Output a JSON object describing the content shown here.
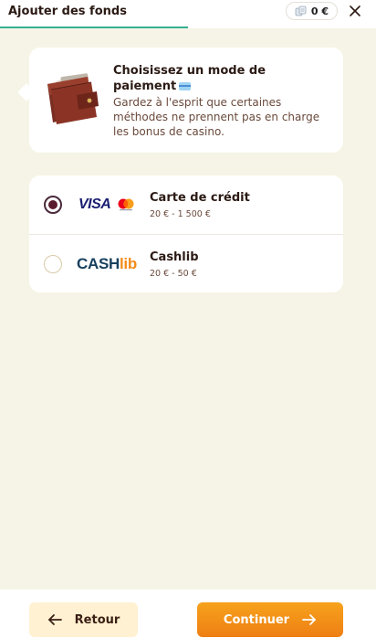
{
  "header": {
    "title": "Ajouter des fonds",
    "balance": "0 €",
    "progress_fraction": 0.5
  },
  "info": {
    "title": "Choisissez un mode de paiement",
    "text": "Gardez à l'esprit que certaines méthodes ne prennent pas en charge les bonus de casino."
  },
  "methods": [
    {
      "logo_text": "VISA",
      "name": "Carte de crédit",
      "range": "20 € - 1 500 €",
      "selected": true
    },
    {
      "logo_text_main": "CASH",
      "logo_text_accent": "lib",
      "name": "Cashlib",
      "range": "20 € - 50 €",
      "selected": false
    }
  ],
  "footer": {
    "back_label": "Retour",
    "continue_label": "Continuer"
  },
  "colors": {
    "accent_orange": "#f39019",
    "progress_green": "#35b090",
    "radio_selected": "#5a1a2e",
    "background": "#f6f4e6"
  },
  "icons": [
    "coins-icon",
    "close-icon",
    "wallet-icon",
    "credit-card-icon",
    "mastercard-icon",
    "arrow-left-icon",
    "arrow-right-icon"
  ]
}
